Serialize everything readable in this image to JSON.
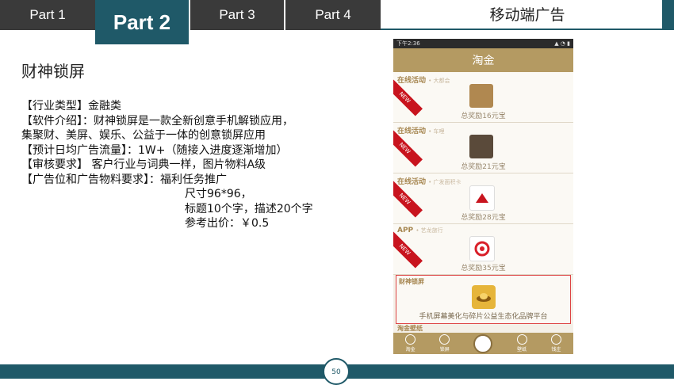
{
  "tabs": [
    "Part 1",
    "Part 2",
    "Part 3",
    "Part 4"
  ],
  "active_tab": "Part 2",
  "right_title": "移动端广告",
  "slide_title": "财神锁屏",
  "body_lines": [
    "【行业类型】金融类",
    "【软件介绍】：财神锁屏是一款全新创意手机解锁应用，",
    "集聚财、美屏、娱乐、公益于一体的创意锁屏应用",
    "【预计日均广告流量】：1W+（随接入进度逐渐增加）",
    "【审核要求】 客户行业与词典一样，图片物料A级",
    "【广告位和广告物料要求】：福利任务推广"
  ],
  "body_indent_lines": [
    "尺寸96*96，",
    "标题10个字，描述20个字",
    "参考出价：￥0.5"
  ],
  "phone": {
    "status_time": "下午2:36",
    "app_title": "淘金",
    "cards": [
      {
        "head": "在线活动",
        "sub": "• 大都会",
        "reward": "总奖励16元宝",
        "thumb_color": "#b08850"
      },
      {
        "head": "在线活动",
        "sub": "• 车哩",
        "reward": "总奖励21元宝",
        "thumb_color": "#5a4a3a"
      },
      {
        "head": "在线活动",
        "sub": "• 广发面积卡",
        "reward": "总奖励28元宝",
        "thumb_color": "#ffffff"
      },
      {
        "head": "APP",
        "sub": "• 艺龙旅行",
        "reward": "总奖励35元宝",
        "thumb_color": "#ffffff"
      }
    ],
    "new_label": "NEW",
    "highlight_head": "财神锁屏",
    "highlight_desc": "手机屏幕美化与碎片公益生态化品牌平台",
    "wallpaper_label": "淘金壁纸",
    "tabbar": [
      "淘金",
      "锁屏",
      "",
      "壁纸",
      "钱庄"
    ]
  },
  "page_number": "50",
  "colors": {
    "accent": "#1f5968",
    "tab_dark": "#3a3a3a",
    "phone_gold": "#b49a62",
    "ribbon_red": "#c8141e"
  }
}
